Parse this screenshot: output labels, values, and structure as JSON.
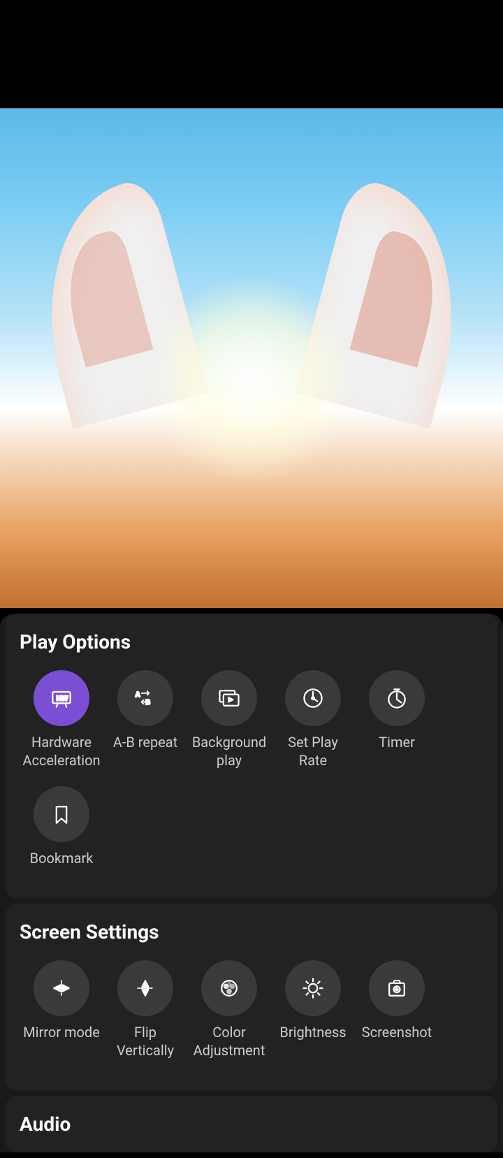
{
  "topBar": {
    "height": 155
  },
  "playOptions": {
    "title": "Play Options",
    "items": [
      {
        "id": "hardware-acceleration",
        "label": "Hardware\nAcceleration",
        "labelLine1": "Hardware",
        "labelLine2": "Acceleration",
        "iconType": "hw",
        "iconCircleClass": "purple"
      },
      {
        "id": "ab-repeat",
        "label": "A-B repeat",
        "labelLine1": "A-B repeat",
        "labelLine2": "",
        "iconType": "ab",
        "iconCircleClass": ""
      },
      {
        "id": "background-play",
        "label": "Background\nplay",
        "labelLine1": "Background",
        "labelLine2": "play",
        "iconType": "screen",
        "iconCircleClass": ""
      },
      {
        "id": "set-play-rate",
        "label": "Set Play\nRate",
        "labelLine1": "Set Play",
        "labelLine2": "Rate",
        "iconType": "speed",
        "iconCircleClass": ""
      },
      {
        "id": "timer",
        "label": "Timer",
        "labelLine1": "Timer",
        "labelLine2": "",
        "iconType": "timer",
        "iconCircleClass": ""
      },
      {
        "id": "bookmark",
        "label": "Bookmark",
        "labelLine1": "Bookmark",
        "labelLine2": "",
        "iconType": "bookmark",
        "iconCircleClass": ""
      }
    ]
  },
  "screenSettings": {
    "title": "Screen Settings",
    "items": [
      {
        "id": "mirror-mode",
        "label": "Mirror mode",
        "labelLine1": "Mirror mode",
        "labelLine2": "",
        "iconType": "mirror"
      },
      {
        "id": "flip-vertically",
        "label": "Flip\nVertically",
        "labelLine1": "Flip",
        "labelLine2": "Vertically",
        "iconType": "flip"
      },
      {
        "id": "color-adjustment",
        "label": "Color\nAdjustment",
        "labelLine1": "Color",
        "labelLine2": "Adjustment",
        "iconType": "color"
      },
      {
        "id": "brightness",
        "label": "Brightness",
        "labelLine1": "Brightness",
        "labelLine2": "",
        "iconType": "brightness"
      },
      {
        "id": "screenshot",
        "label": "Screenshot",
        "labelLine1": "Screenshot",
        "labelLine2": "",
        "iconType": "screenshot"
      }
    ]
  },
  "audio": {
    "title": "Audio"
  }
}
